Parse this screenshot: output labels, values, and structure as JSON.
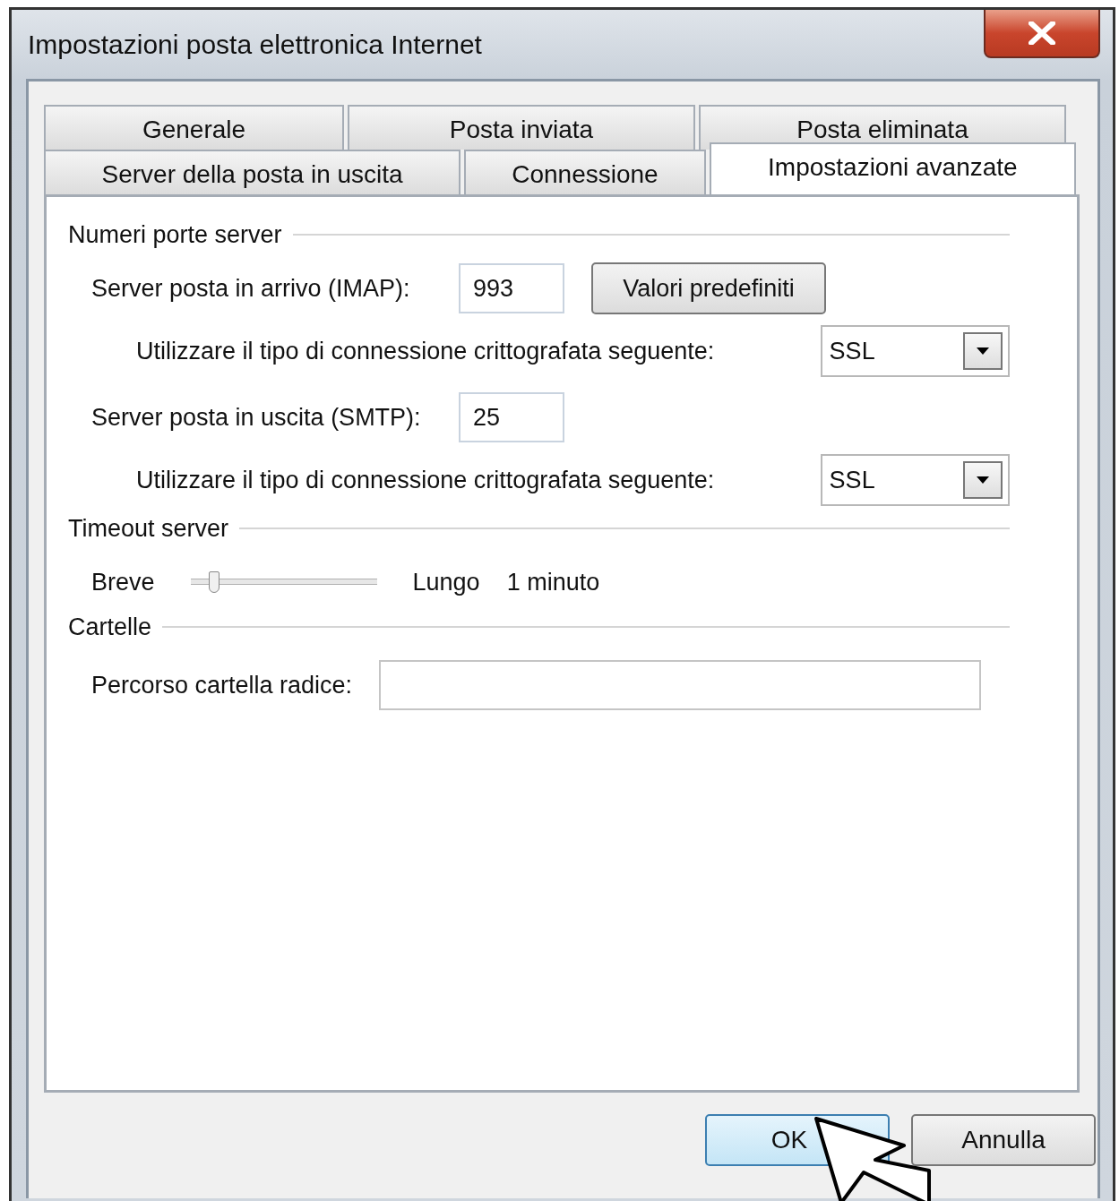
{
  "window": {
    "title": "Impostazioni posta elettronica Internet"
  },
  "tab_rows": [
    [
      {
        "label": "Generale",
        "selected": false
      },
      {
        "label": "Posta inviata",
        "selected": false
      },
      {
        "label": "Posta eliminata",
        "selected": false
      }
    ],
    [
      {
        "label": "Server della posta in uscita",
        "selected": false
      },
      {
        "label": "Connessione",
        "selected": false
      },
      {
        "label": "Impostazioni avanzate",
        "selected": true
      }
    ]
  ],
  "sections": [
    {
      "title": "Numeri porte server",
      "rows": [
        {
          "kind": "port",
          "label": "Server posta in arrivo (IMAP):",
          "value": "993",
          "button": "Valori predefiniti"
        },
        {
          "kind": "encryption",
          "label": "Utilizzare il tipo di connessione crittografata seguente:",
          "value": "SSL"
        },
        {
          "kind": "port",
          "label": "Server posta in uscita (SMTP):",
          "value": "25"
        },
        {
          "kind": "encryption",
          "label": "Utilizzare il tipo di connessione crittografata seguente:",
          "value": "SSL"
        }
      ]
    },
    {
      "title": "Timeout server",
      "rows": [
        {
          "kind": "slider",
          "min_label": "Breve",
          "max_label": "Lungo",
          "level": 0.1,
          "reading": "1 minuto"
        }
      ]
    },
    {
      "title": "Cartelle",
      "rows": [
        {
          "kind": "text",
          "label": "Percorso cartella radice:"
        }
      ]
    }
  ],
  "buttons": [
    {
      "label": "OK",
      "default": true
    },
    {
      "label": "Annulla",
      "default": false
    }
  ]
}
